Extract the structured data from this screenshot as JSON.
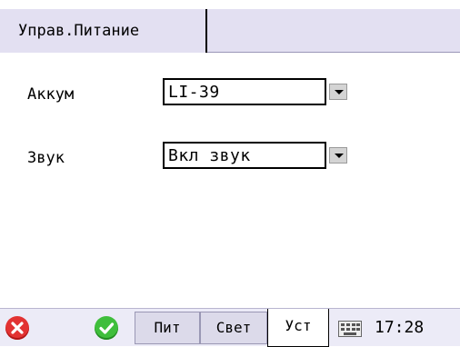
{
  "header": {
    "tab_label": "Управ.Питание"
  },
  "form": {
    "battery": {
      "label": "Аккум",
      "value": "LI-39"
    },
    "sound": {
      "label": "Звук",
      "value": "Вкл звук"
    }
  },
  "taskbar": {
    "buttons": [
      "Пит",
      "Свет",
      "Уст"
    ],
    "active_button": "Уст",
    "time": "17:28",
    "colors": {
      "close": "#e23232",
      "ok": "#3fbe3c"
    }
  }
}
